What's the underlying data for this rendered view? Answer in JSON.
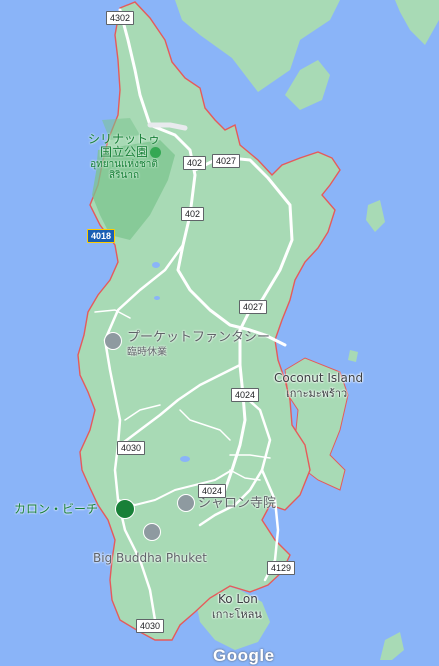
{
  "map": {
    "places": {
      "coconut_island": {
        "name": "Coconut Island",
        "thai": "เกาะมะพร้าว"
      },
      "ko_lon": {
        "name": "Ko Lon",
        "thai": "เกาะโหลน"
      }
    },
    "park": {
      "line1": "シリナットゥ",
      "line2": "国立公園",
      "thai1": "อุทยานแห่งชาติ",
      "thai2": "สิรินาถ"
    },
    "pois": {
      "phuket_fantasea": {
        "name": "プーケットファンタシー",
        "status": "臨時休業"
      },
      "karon_beach": {
        "name": "カロン・ビーチ"
      },
      "chalong_temple": {
        "name": "シャロン寺院"
      },
      "big_buddha": {
        "name": "Big Buddha Phuket"
      }
    },
    "shields": {
      "r4302": "4302",
      "r402a": "402",
      "r4027a": "4027",
      "r402b": "402",
      "r4018": "4018",
      "r4027b": "4027",
      "r4024a": "4024",
      "r4030a": "4030",
      "r4024b": "4024",
      "r4129": "4129",
      "r4030b": "4030"
    },
    "attribution": "Google",
    "colors": {
      "water": "#8ab4f8",
      "land": "#a8dab5",
      "park": "#7cc48f",
      "boundary": "#e65a5a",
      "road": "#ffffff"
    }
  }
}
